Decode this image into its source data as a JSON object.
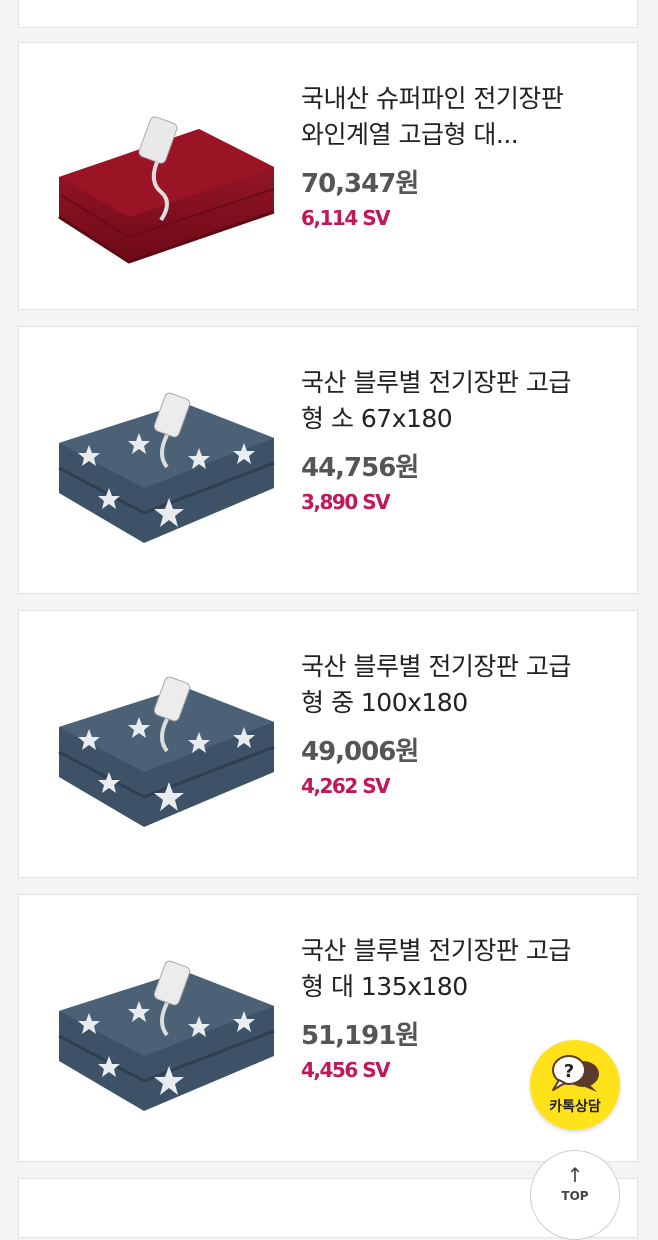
{
  "products": [
    {
      "title_line1": "국내산 슈퍼파인 전기장판",
      "title_line2": "와인계열 고급형 대...",
      "price": "70,347원",
      "sv": "6,114 SV",
      "image": "wine-red-electric-mat"
    },
    {
      "title_line1": "국산 블루별 전기장판 고급",
      "title_line2": "형 소 67x180",
      "price": "44,756원",
      "sv": "3,890 SV",
      "image": "blue-star-electric-mat"
    },
    {
      "title_line1": "국산 블루별 전기장판 고급",
      "title_line2": "형 중 100x180",
      "price": "49,006원",
      "sv": "4,262 SV",
      "image": "blue-star-electric-mat"
    },
    {
      "title_line1": "국산 블루별 전기장판 고급",
      "title_line2": "형 대 135x180",
      "price": "51,191원",
      "sv": "4,456 SV",
      "image": "blue-star-electric-mat"
    }
  ],
  "kakao": {
    "label": "카톡상담",
    "icon": "question-bubble-icon"
  },
  "top_button": {
    "label": "TOP",
    "icon": "up-arrow-icon"
  },
  "colors": {
    "accent_sv": "#c0185a",
    "kakao_yellow": "#ffe21a",
    "mat_red": "#8e1020",
    "mat_blue": "#3f5569"
  }
}
